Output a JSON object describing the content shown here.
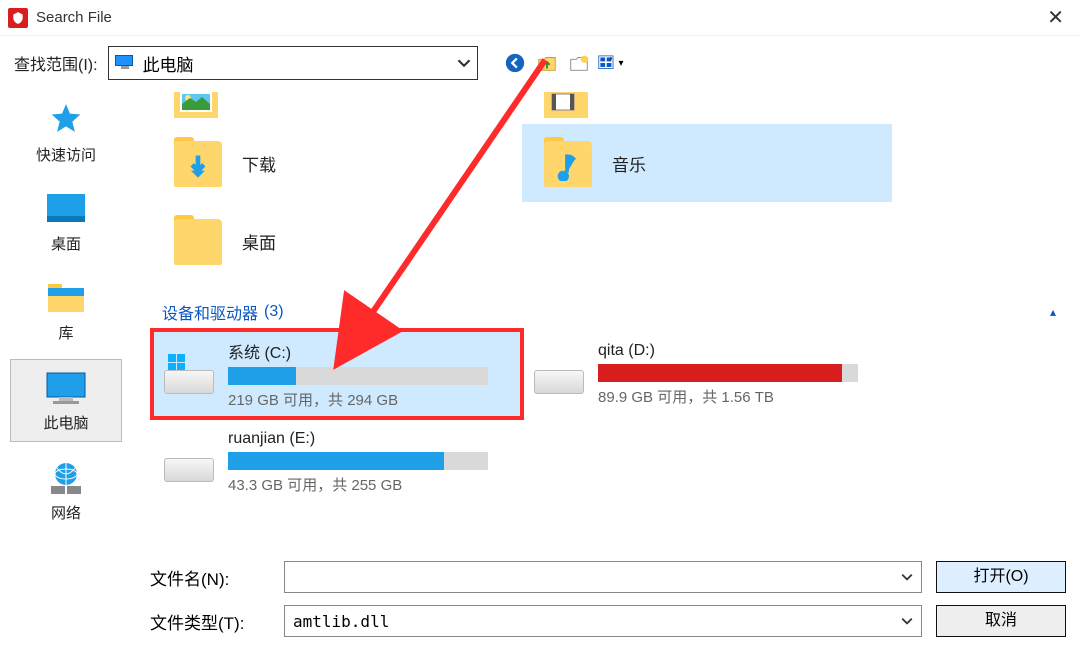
{
  "window": {
    "title": "Search File"
  },
  "toolbar": {
    "lookin_label": "查找范围(I):",
    "lookin_value": "此电脑"
  },
  "sidebar": {
    "items": [
      {
        "label": "快速访问"
      },
      {
        "label": "桌面"
      },
      {
        "label": "库"
      },
      {
        "label": "此电脑"
      },
      {
        "label": "网络"
      }
    ]
  },
  "content": {
    "truncated_row": [
      {
        "label": ""
      },
      {
        "label": ""
      }
    ],
    "folders": [
      {
        "label": "下载",
        "icon": "download"
      },
      {
        "label": "音乐",
        "icon": "music",
        "selected": true
      },
      {
        "label": "桌面",
        "icon": "folder"
      }
    ],
    "section": {
      "title": "设备和驱动器",
      "count": "(3)"
    },
    "drives": [
      {
        "name": "系统 (C:)",
        "stat": "219 GB 可用，共 294 GB",
        "fill_pct": 26,
        "fill_color": "#1e9fe8",
        "selected": true,
        "highlighted": true,
        "winlogo": true
      },
      {
        "name": "qita (D:)",
        "stat": "89.9 GB 可用，共 1.56 TB",
        "fill_pct": 94,
        "fill_color": "#d81e1e"
      },
      {
        "name": "ruanjian (E:)",
        "stat": "43.3 GB 可用，共 255 GB",
        "fill_pct": 83,
        "fill_color": "#1e9fe8"
      }
    ]
  },
  "footer": {
    "filename_label": "文件名(N):",
    "filename_value": "",
    "filetype_label": "文件类型(T):",
    "filetype_value": "amtlib.dll",
    "open_label": "打开(O)",
    "cancel_label": "取消"
  }
}
